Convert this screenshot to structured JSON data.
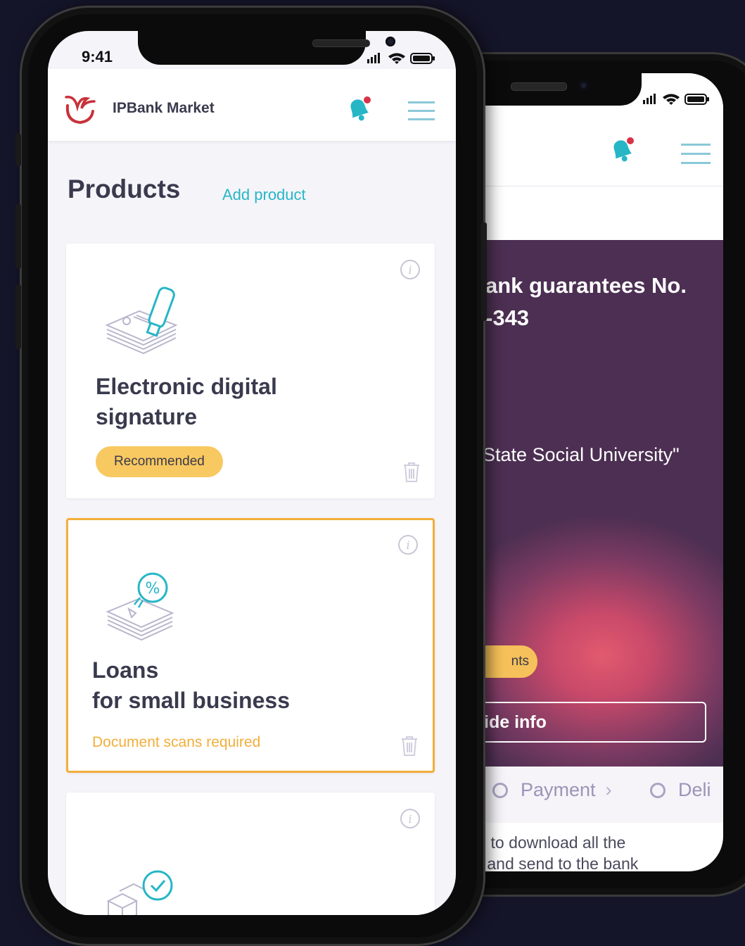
{
  "front": {
    "status_time": "9:41",
    "brand": "IPBank Market",
    "page_title": "Products",
    "add_product": "Add product",
    "cards": [
      {
        "title": "Electronic digital\nsignature",
        "badge": "Recommended",
        "icon": "signature-token-icon"
      },
      {
        "title": "Loans\nfor small business",
        "note": "Document scans required",
        "icon": "loan-percent-icon"
      },
      {
        "title": "",
        "icon": "insurance-check-icon"
      }
    ]
  },
  "back": {
    "hero_title": "ank guarantees No.\n-343",
    "hero_subtitle": "State Social University\"",
    "pill": "nts",
    "button": "ide info",
    "steps": [
      {
        "label": "Payment"
      },
      {
        "label": "Deli"
      }
    ],
    "bottom_text": "l to download all the\n and send to the bank"
  },
  "colors": {
    "accent": "#26b6c6",
    "badge": "#f8c861",
    "highlight": "#f2ae3a",
    "hero": "#4c2f52",
    "brand_red": "#c8323a"
  }
}
